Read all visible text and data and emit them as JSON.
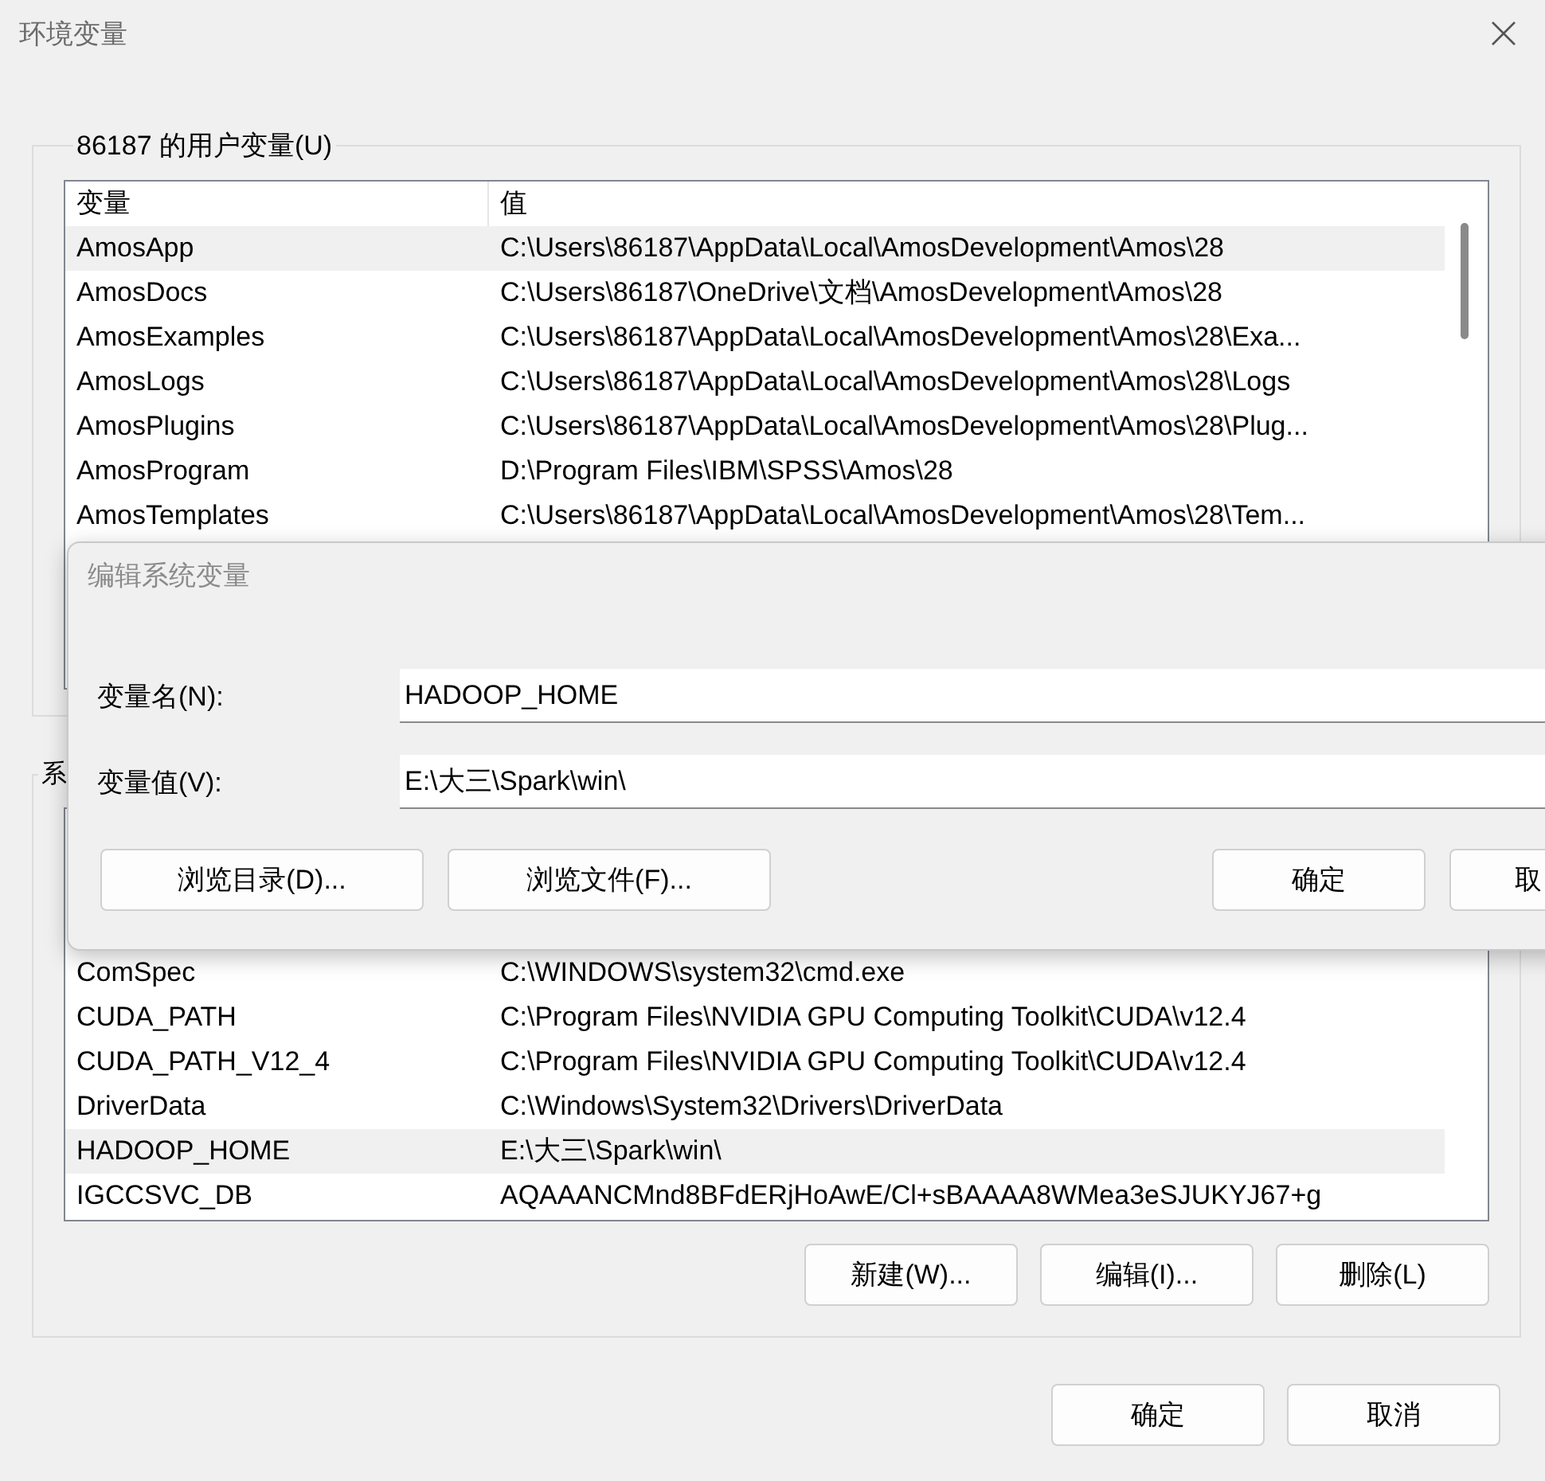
{
  "window": {
    "title": "环境变量"
  },
  "user_variables": {
    "label": "86187 的用户变量(U)",
    "columns": [
      "变量",
      "值"
    ],
    "rows": [
      {
        "name": "AmosApp",
        "value": "C:\\Users\\86187\\AppData\\Local\\AmosDevelopment\\Amos\\28",
        "selected": true
      },
      {
        "name": "AmosDocs",
        "value": "C:\\Users\\86187\\OneDrive\\文档\\AmosDevelopment\\Amos\\28",
        "selected": false
      },
      {
        "name": "AmosExamples",
        "value": "C:\\Users\\86187\\AppData\\Local\\AmosDevelopment\\Amos\\28\\Exa...",
        "selected": false
      },
      {
        "name": "AmosLogs",
        "value": "C:\\Users\\86187\\AppData\\Local\\AmosDevelopment\\Amos\\28\\Logs",
        "selected": false
      },
      {
        "name": "AmosPlugins",
        "value": "C:\\Users\\86187\\AppData\\Local\\AmosDevelopment\\Amos\\28\\Plug...",
        "selected": false
      },
      {
        "name": "AmosProgram",
        "value": "D:\\Program Files\\IBM\\SPSS\\Amos\\28",
        "selected": false
      },
      {
        "name": "AmosTemplates",
        "value": "C:\\Users\\86187\\AppData\\Local\\AmosDevelopment\\Amos\\28\\Tem...",
        "selected": false
      }
    ]
  },
  "system_variables": {
    "label": "系",
    "rows": [
      {
        "name": "ComSpec",
        "value": "C:\\WINDOWS\\system32\\cmd.exe",
        "selected": false
      },
      {
        "name": "CUDA_PATH",
        "value": "C:\\Program Files\\NVIDIA GPU Computing Toolkit\\CUDA\\v12.4",
        "selected": false
      },
      {
        "name": "CUDA_PATH_V12_4",
        "value": "C:\\Program Files\\NVIDIA GPU Computing Toolkit\\CUDA\\v12.4",
        "selected": false
      },
      {
        "name": "DriverData",
        "value": "C:\\Windows\\System32\\Drivers\\DriverData",
        "selected": false
      },
      {
        "name": "HADOOP_HOME",
        "value": "E:\\大三\\Spark\\win\\",
        "selected": true
      },
      {
        "name": "IGCCSVC_DB",
        "value": "AQAAANCMnd8BFdERjHoAwE/Cl+sBAAAA8WMea3eSJUKYJ67+g",
        "selected": false
      }
    ],
    "buttons": [
      "新建(W)...",
      "编辑(I)...",
      "删除(L)"
    ]
  },
  "buttons": [
    "确定",
    "取消"
  ],
  "edit_dialog": {
    "title": "编辑系统变量",
    "fields": [
      {
        "label": "变量名(N):",
        "value": "HADOOP_HOME"
      },
      {
        "label": "变量值(V):",
        "value": "E:\\大三\\Spark\\win\\"
      }
    ],
    "buttons": [
      "浏览目录(D)...",
      "浏览文件(F)...",
      "确定",
      "取"
    ]
  }
}
